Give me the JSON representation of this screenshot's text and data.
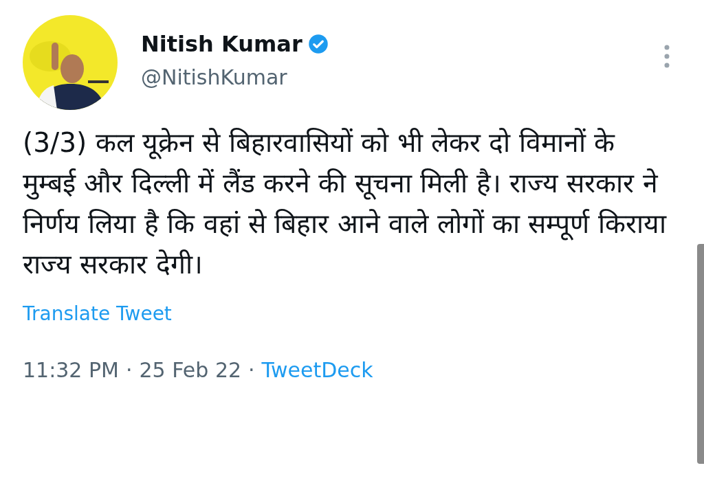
{
  "author": {
    "name": "Nitish Kumar",
    "verified": true,
    "handle": "@NitishKumar"
  },
  "tweet": {
    "text": "(3/3) कल यूक्रेन से बिहारवासियों को भी लेकर दो विमानों के मुम्बई और दिल्ली में लैंड करने की सूचना मिली है। राज्य सरकार ने निर्णय लिया है कि वहां से बिहार आने वाले लोगों का सम्पूर्ण किराया राज्य सरकार देगी।"
  },
  "translate_link": "Translate Tweet",
  "meta": {
    "time": "11:32 PM",
    "separator_1": "·",
    "date": "25 Feb 22",
    "separator_2": "·",
    "source": "TweetDeck"
  }
}
